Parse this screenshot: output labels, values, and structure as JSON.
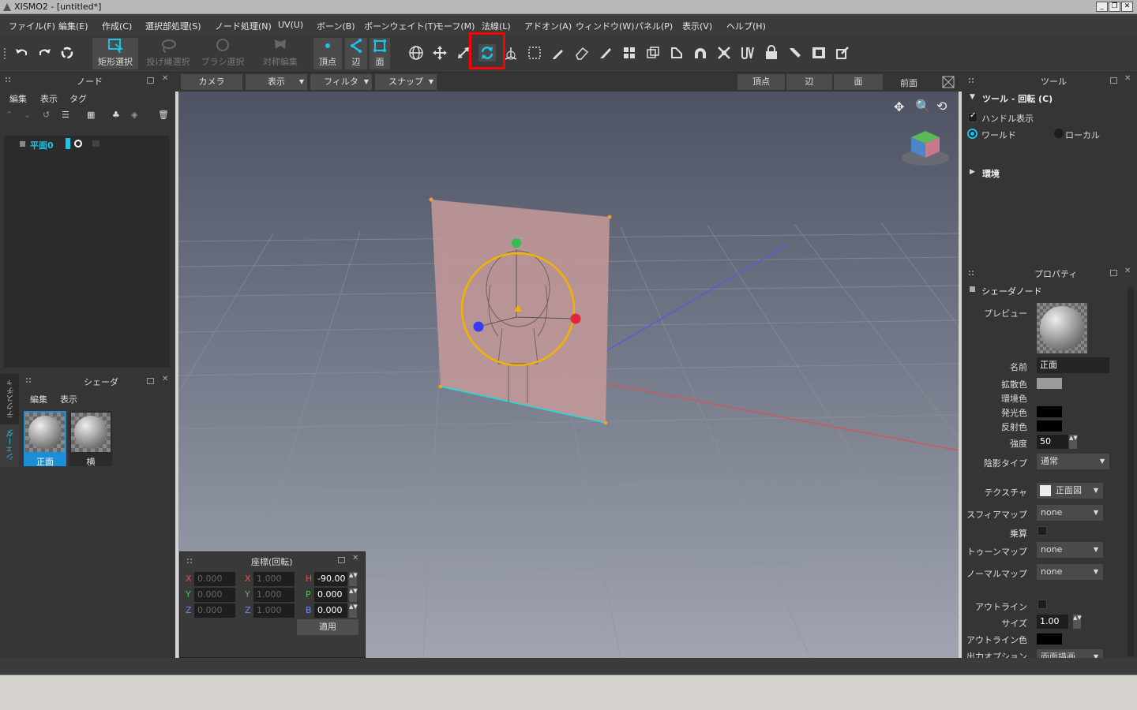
{
  "title": "XISMO2 - [untitled*]",
  "menu": [
    "ファイル(F)",
    "編集(E)",
    "作成(C)",
    "選択部処理(S)",
    "ノード処理(N)",
    "UV(U)",
    "ボーン(B)",
    "ボーンウェイト(T)",
    "モーフ(M)",
    "法線(L)",
    "アドオン(A)",
    "ウィンドウ(W)",
    "パネル(P)",
    "表示(V)",
    "ヘルプ(H)"
  ],
  "toolbar": {
    "rect_select": "矩形選択",
    "lasso_select": "投げ縄選択",
    "brush_select": "ブラシ選択",
    "sym_edit": "対称編集",
    "vertex": "頂点",
    "edge": "辺",
    "face": "面"
  },
  "node_panel": {
    "title": "ノード",
    "menu": [
      "編集",
      "表示",
      "タグ"
    ],
    "item": "平面0"
  },
  "shader_panel": {
    "title": "シェーダ",
    "menu": [
      "編集",
      "表示"
    ],
    "items": [
      "正面",
      "横"
    ],
    "side_tabs": [
      "テクスチャ",
      "シェーダ"
    ]
  },
  "viewport": {
    "tabs": [
      "カメラ",
      "表示",
      "フィルタ",
      "スナップ"
    ],
    "modes": [
      "頂点",
      "辺",
      "面"
    ],
    "view_name": "前面"
  },
  "coord_panel": {
    "title": "座標(回転)",
    "rows": [
      {
        "a": "X",
        "av": "0.000",
        "b": "X",
        "bv": "1.000",
        "c": "H",
        "cv": "-90.00"
      },
      {
        "a": "Y",
        "av": "0.000",
        "b": "Y",
        "bv": "1.000",
        "c": "P",
        "cv": "0.000"
      },
      {
        "a": "Z",
        "av": "0.000",
        "b": "Z",
        "bv": "1.000",
        "c": "B",
        "cv": "0.000"
      }
    ],
    "apply": "適用"
  },
  "tool_panel": {
    "title": "ツール",
    "section": "ツール - 回転 (C)",
    "handle": "ハンドル表示",
    "world": "ワールド",
    "local": "ローカル",
    "env": "環境"
  },
  "prop_panel": {
    "title": "プロパティ",
    "section": "シェーダノード",
    "preview": "プレビュー",
    "name_label": "名前",
    "name_value": "正面",
    "diffuse": "拡散色",
    "ambient": "環境色",
    "emissive": "発光色",
    "specular": "反射色",
    "strength": "強度",
    "strength_value": "50",
    "shadow_type": "陰影タイプ",
    "shadow_value": "通常",
    "texture": "テクスチャ",
    "texture_value": "正面図",
    "sphere": "スフィアマップ",
    "sphere_value": "none",
    "multiply": "乗算",
    "toon": "トゥーンマップ",
    "toon_value": "none",
    "normal": "ノーマルマップ",
    "normal_value": "none",
    "outline": "アウトライン",
    "size": "サイズ",
    "size_value": "1.00",
    "outline_color": "アウトライン色",
    "output_option": "出力オプション",
    "output_value": "両面描画"
  },
  "colors": {
    "accent": "#00c8e8",
    "highlight": "#ff0000",
    "gizmo": "#f0b400"
  }
}
